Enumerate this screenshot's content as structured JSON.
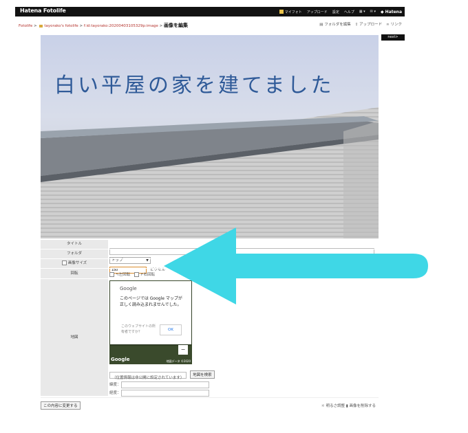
{
  "topbar": {
    "logo": "Hatena Fotolife",
    "items": [
      "マイフォト",
      "アップロード",
      "設定",
      "ヘルプ",
      "▦ ▾",
      "✉ ▾"
    ],
    "brand": "◆ Hatena"
  },
  "breadcrumb": {
    "link1": "Fotolife",
    "sep": " > ",
    "link2": "tayorako's fotolife",
    "link3": "f:id:tayorako:20200403105329p:image",
    "current": "画像を編集"
  },
  "actions": [
    "フォルダを編集",
    "アップロード",
    "リンク"
  ],
  "next_label": "next>",
  "photo": {
    "title": "白い平屋の家を建てました"
  },
  "form": {
    "labels": {
      "title": "タイトル",
      "folder": "フォルダ",
      "size": "画像サイズ",
      "rotate": "回転",
      "location": "地図"
    },
    "folder_value": "トップ",
    "size_value": "150",
    "size_unit": "ピクセル",
    "rotate_left": "左回転",
    "rotate_right": "右回転",
    "map_dialog": {
      "brand": "Google",
      "message": "このページでは Google マップが正しく読み込まれませんでした。",
      "owner_question": "このウェブサイトの所有者ですか？",
      "ok": "OK"
    },
    "map_footer": "地図データ ©2020",
    "map_zoom_minus": "−",
    "search_button": "地図を検索",
    "location_note": "（位置情報は非公開に設定されています）",
    "lat_label": "緯度：",
    "lng_label": "経度：",
    "submit": "この内容に変更する",
    "bottom_links": [
      "明るさ調整",
      "画像を削除する"
    ]
  },
  "colors": {
    "topbar": "#121212",
    "link": "#b4332d",
    "arrow": "#3fd7e6",
    "label_bg": "#e9e9e9"
  }
}
